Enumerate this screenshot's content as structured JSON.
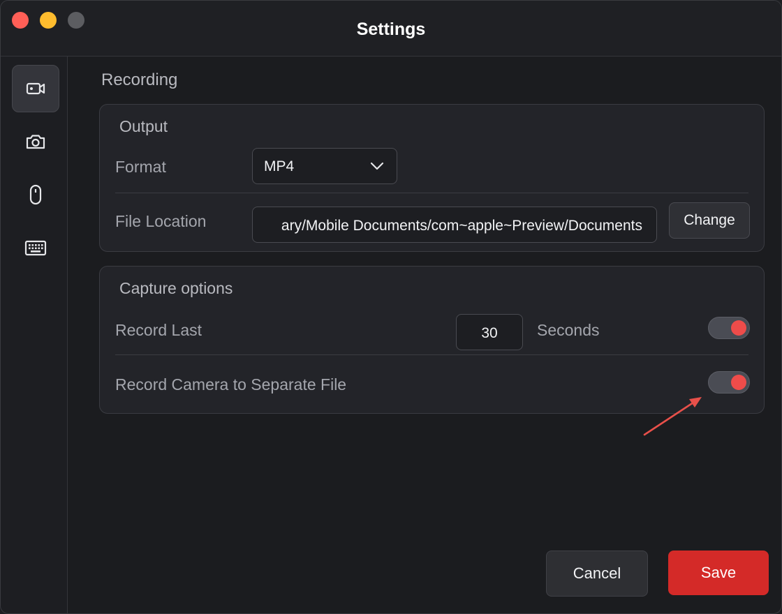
{
  "window": {
    "title": "Settings"
  },
  "sidebar": {
    "items": [
      {
        "icon": "video-camera-icon",
        "active": true
      },
      {
        "icon": "camera-icon",
        "active": false
      },
      {
        "icon": "mouse-icon",
        "active": false
      },
      {
        "icon": "keyboard-icon",
        "active": false
      }
    ]
  },
  "main": {
    "section_title": "Recording",
    "output": {
      "title": "Output",
      "format_label": "Format",
      "format_value": "MP4",
      "file_location_label": "File Location",
      "file_location_value": "ary/Mobile Documents/com~apple~Preview/Documents",
      "change_label": "Change"
    },
    "capture": {
      "title": "Capture options",
      "record_last_label": "Record Last",
      "record_last_value": "30",
      "seconds_label": "Seconds",
      "record_last_toggle": "on",
      "camera_separate_label": "Record Camera to Separate File",
      "camera_separate_toggle": "on"
    }
  },
  "footer": {
    "cancel_label": "Cancel",
    "save_label": "Save"
  },
  "colors": {
    "accent": "#d42a28",
    "toggle_knob": "#ee4c4a",
    "annotation_arrow": "#e8504a"
  }
}
